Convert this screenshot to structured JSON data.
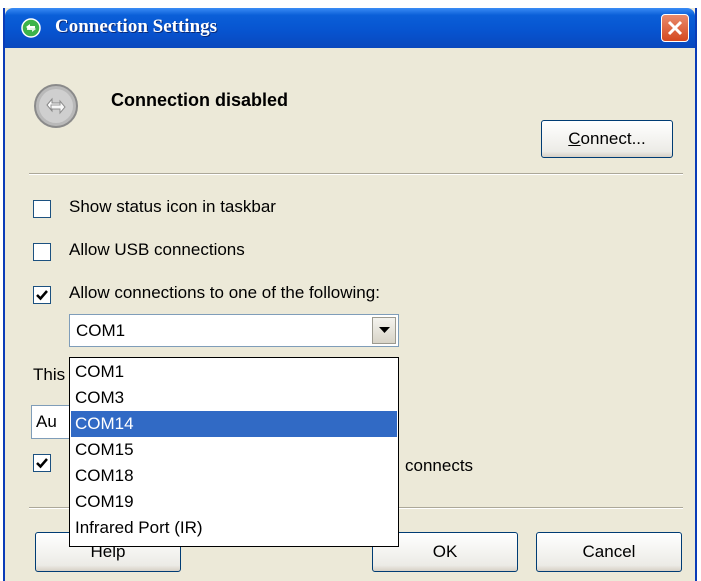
{
  "window": {
    "title": "Connection Settings"
  },
  "status": {
    "text": "Connection disabled"
  },
  "buttons": {
    "connect": "Connect...",
    "help": "Help",
    "ok": "OK",
    "cancel": "Cancel"
  },
  "options": {
    "show_status_icon": {
      "label": "Show status icon in taskbar",
      "checked": false
    },
    "allow_usb": {
      "label": "Allow USB connections",
      "checked": false
    },
    "allow_connections_to": {
      "label": "Allow connections to one of the following:",
      "checked": true
    }
  },
  "port_select": {
    "value": "COM1",
    "options": [
      "COM1",
      "COM3",
      "COM14",
      "COM15",
      "COM18",
      "COM19",
      "Infrared Port (IR)"
    ],
    "highlighted": "COM14"
  },
  "partially_hidden": {
    "label_fragment": "This",
    "combo_fragment": "Au",
    "checkbox_label_fragment": "connects",
    "checkbox_checked": true
  },
  "colors": {
    "title_bar": "#0753cf",
    "dialog_bg": "#ece9d8",
    "highlight": "#316ac5"
  }
}
